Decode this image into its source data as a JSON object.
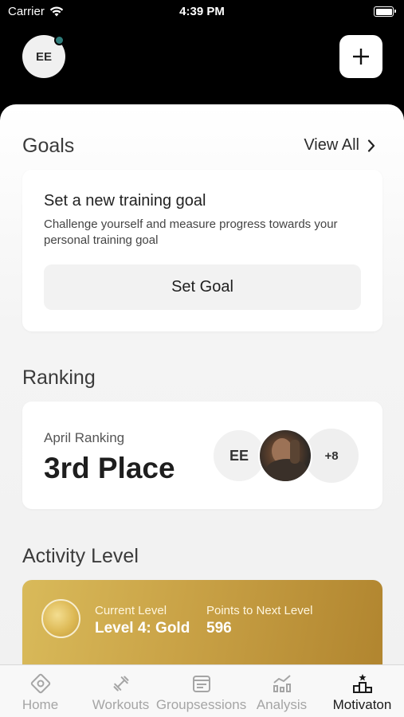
{
  "status_bar": {
    "carrier": "Carrier",
    "time": "4:39 PM"
  },
  "header": {
    "avatar_initials": "EE",
    "add_icon": "plus-icon"
  },
  "goals": {
    "title": "Goals",
    "view_all": "View All",
    "card_heading": "Set a new training goal",
    "card_description": "Challenge yourself and measure progress towards your personal training goal",
    "button_label": "Set Goal"
  },
  "ranking": {
    "title": "Ranking",
    "subtitle": "April Ranking",
    "place": "3rd Place",
    "avatar_initials": "EE",
    "more_count": "+8"
  },
  "activity": {
    "title": "Activity Level",
    "current_level_label": "Current Level",
    "current_level_value": "Level 4: Gold",
    "points_label": "Points to Next Level",
    "points_value": "596"
  },
  "tabs": [
    {
      "label": "Home",
      "icon": "home-icon",
      "active": false
    },
    {
      "label": "Workouts",
      "icon": "dumbbell-icon",
      "active": false
    },
    {
      "label": "Groupsessions",
      "icon": "calendar-icon",
      "active": false
    },
    {
      "label": "Analysis",
      "icon": "chart-icon",
      "active": false
    },
    {
      "label": "Motivaton",
      "icon": "podium-icon",
      "active": true
    }
  ],
  "colors": {
    "accent_gold": "#c9a246",
    "presence": "#2f7d7b"
  }
}
